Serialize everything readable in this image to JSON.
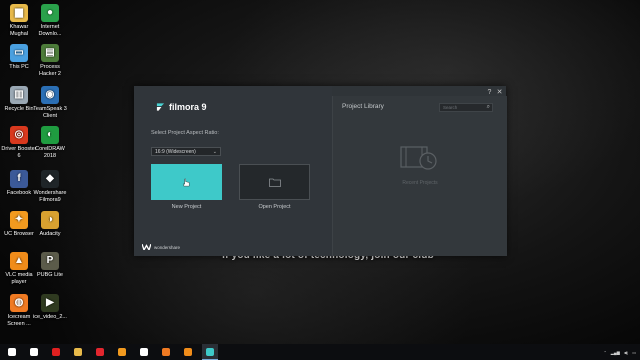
{
  "desktop": {
    "icons": [
      {
        "label": "Khawar Mughal",
        "icon": "folder-user-icon",
        "color": "#e7b94a",
        "glyph": "▆"
      },
      {
        "label": "Internet Downlo...",
        "icon": "internet-download-manager-icon",
        "color": "#2aa14b",
        "glyph": "●"
      },
      {
        "label": "This PC",
        "icon": "computer-icon",
        "color": "#4aa0e0",
        "glyph": "▭"
      },
      {
        "label": "Process Hacker 2",
        "icon": "process-hacker-icon",
        "color": "#4d7c3a",
        "glyph": "▤"
      },
      {
        "label": "Recycle Bin",
        "icon": "recycle-bin-icon",
        "color": "#9aa8b4",
        "glyph": "▥"
      },
      {
        "label": "TeamSpeak 3 Client",
        "icon": "teamspeak-icon",
        "color": "#2b6fb5",
        "glyph": "◉"
      },
      {
        "label": "Driver Booster 6",
        "icon": "driver-booster-icon",
        "color": "#d9391e",
        "glyph": "◎"
      },
      {
        "label": "CorelDRAW 2018",
        "icon": "coreldraw-icon",
        "color": "#1f9c40",
        "glyph": "◐"
      },
      {
        "label": "Facebook",
        "icon": "facebook-icon",
        "color": "#3b5998",
        "glyph": "f"
      },
      {
        "label": "Wondershare Filmora9",
        "icon": "filmora-icon",
        "color": "#1f2528",
        "glyph": "◆"
      },
      {
        "label": "UC Browser",
        "icon": "uc-browser-icon",
        "color": "#f29a1f",
        "glyph": "✦"
      },
      {
        "label": "Audacity",
        "icon": "audacity-icon",
        "color": "#d8a130",
        "glyph": "◑"
      },
      {
        "label": "VLC media player",
        "icon": "vlc-icon",
        "color": "#f08c1a",
        "glyph": "▲"
      },
      {
        "label": "PUBG Lite",
        "icon": "pubg-icon",
        "color": "#5b5b4a",
        "glyph": "P"
      },
      {
        "label": "Icecream Screen ...",
        "icon": "icecream-screen-recorder-icon",
        "color": "#f07a22",
        "glyph": "◍"
      },
      {
        "label": "ice_video_2...",
        "icon": "video-file-icon",
        "color": "#2f3a20",
        "glyph": "▶"
      }
    ]
  },
  "subtitle": "if you like a lot of technology, join our club",
  "filmora": {
    "logo_text": "filmora 9",
    "aspect_label": "Select Project Aspect Ratio:",
    "aspect_value": "16:9 (Widescreen)",
    "new_project_label": "New Project",
    "open_project_label": "Open Project",
    "brand_text": "wondershare",
    "library_title": "Project Library",
    "search_placeholder": "Search",
    "recent_projects_label": "Recent Projects",
    "accent": "#3ec9c9"
  },
  "taskbar": {
    "items": [
      {
        "icon": "windows-start-icon",
        "color": "#ffffff"
      },
      {
        "icon": "task-view-icon",
        "color": "#ffffff"
      },
      {
        "icon": "record-icon",
        "color": "#e02020"
      },
      {
        "icon": "file-explorer-icon",
        "color": "#e7b94a"
      },
      {
        "icon": "opera-icon",
        "color": "#e3262e"
      },
      {
        "icon": "uc-browser-icon",
        "color": "#f29a1f"
      },
      {
        "icon": "filmora-taskbar-icon",
        "color": "#ffffff"
      },
      {
        "icon": "pumpkin-icon",
        "color": "#f07a22"
      },
      {
        "icon": "vlc-icon",
        "color": "#f08c1a"
      },
      {
        "icon": "filmora-active-icon",
        "color": "#3ec9c9"
      }
    ]
  }
}
